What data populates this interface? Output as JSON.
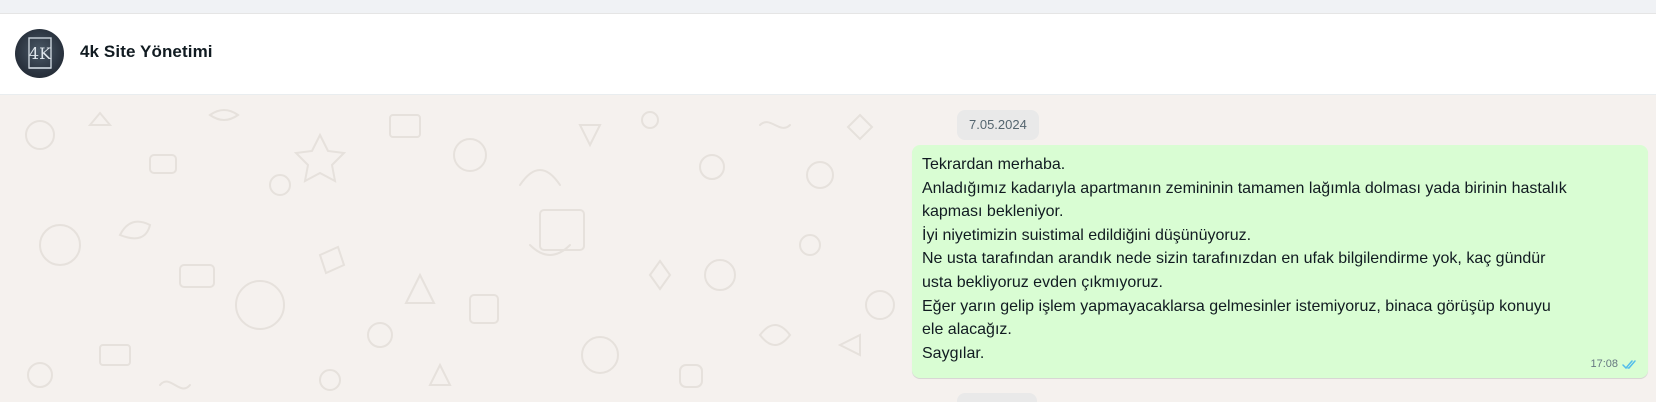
{
  "header": {
    "contact_name": "4k Site Yönetimi",
    "avatar_text": "4K"
  },
  "chat": {
    "date_chip": "7.05.2024",
    "message": {
      "lines": [
        "Tekrardan merhaba.",
        "Anladığımız kadarıyla apartmanın zemininin tamamen lağımla dolması yada birinin hastalık",
        "kapması bekleniyor.",
        "İyi niyetimizin suistimal edildiğini düşünüyoruz.",
        "Ne usta tarafından arandık nede sizin tarafınızdan en ufak bilgilendirme yok, kaç gündür",
        "usta bekliyoruz evden çıkmıyoruz.",
        "Eğer yarın gelip işlem yapmayacaklarsa gelmesinler istemiyoruz, binaca görüşüp konuyu",
        "ele alacağız.",
        "Saygılar."
      ],
      "time": "17:08",
      "status_icon": "double-check-read-icon"
    }
  },
  "colors": {
    "outgoing_bubble": "#d9fdd3",
    "chat_background": "#f5f1ee",
    "read_tick": "#53bdeb",
    "date_chip_bg": "#e9e9e9"
  }
}
